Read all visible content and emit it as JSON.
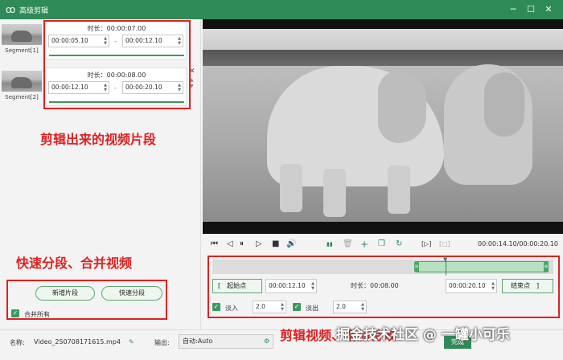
{
  "window": {
    "title": "高级剪辑",
    "minimize": "─",
    "maximize": "☐",
    "close": "✕"
  },
  "segments": [
    {
      "label": "Segment[1]",
      "duration": "时长：00:00:07.00",
      "start": "00:00:05.10",
      "end": "00:00:12.10"
    },
    {
      "label": "Segment[2]",
      "duration": "时长：00:00:08.00",
      "start": "00:00:12.10",
      "end": "00:00:20.10"
    }
  ],
  "segment_separator": "-",
  "annotations": {
    "segments_caption": "剪辑出来的视频片段",
    "split_merge_caption": "快速分段、合并视频",
    "edit_caption": "剪辑视频、增加特效"
  },
  "left_actions": {
    "new_segment": "新增片段",
    "quick_split": "快速分段",
    "merge_all": "合并所有"
  },
  "player": {
    "timecode": "00:00:14.10/00:00:20.10",
    "icons": {
      "prev": "⏮",
      "step_back": "◁",
      "pause": "⏸",
      "step_forward": "▷",
      "stop": "■",
      "volume": "🔊",
      "split": "▮▮",
      "delete": "🗑",
      "add": "+",
      "copy": "❐",
      "rotate": "↻",
      "bracket_in": "[▷]",
      "bracket_out": "[▢]"
    }
  },
  "range": {
    "start_button": "[　起始点",
    "start_time": "00:00:12.10",
    "duration": "时长：00:08.00",
    "end_time": "00:00:20.10",
    "end_button": "结束点　]"
  },
  "fade": {
    "fade_in_label": "淡入",
    "fade_in_value": "2.0",
    "fade_out_label": "淡出",
    "fade_out_value": "2.0"
  },
  "bottom": {
    "name_label": "名称:",
    "name_value": "Video_250708171615.mp4",
    "output_label": "输出:",
    "output_value": "自动:Auto",
    "done_button": "完成",
    "watermark": "掘金技术社区 @ 一罐小可乐"
  },
  "colors": {
    "accent": "#2e8b57",
    "annotation": "#e02020"
  }
}
